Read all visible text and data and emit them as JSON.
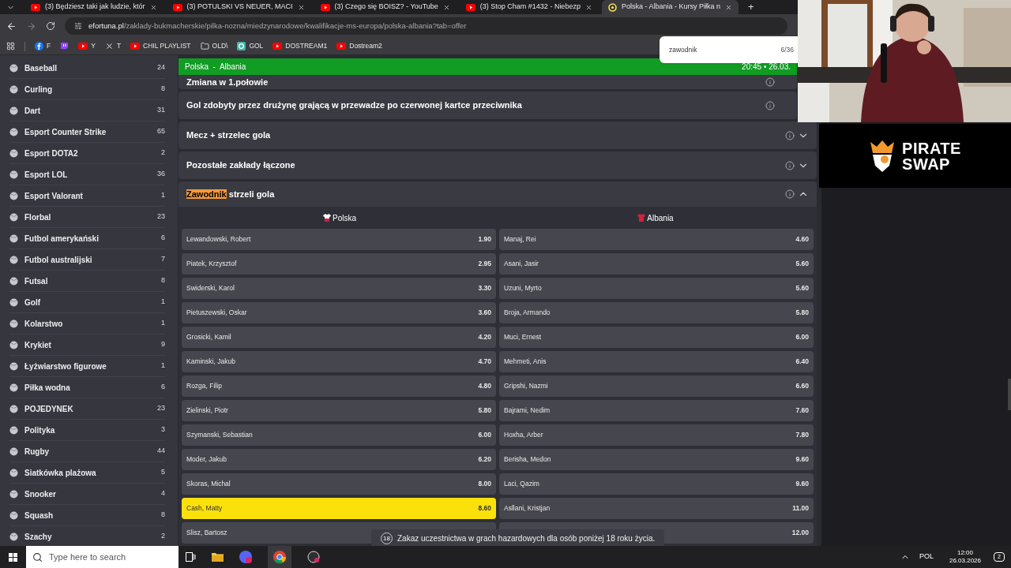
{
  "browser": {
    "tabs": [
      {
        "title": "(3) Będziesz taki jak ludzie, któr",
        "kind": "youtube",
        "selected": false
      },
      {
        "title": "(3) POTULSKI VS NEUER, MACI",
        "kind": "youtube",
        "selected": false
      },
      {
        "title": "(3) Czego się BOISZ? - YouTube",
        "kind": "youtube",
        "selected": false
      },
      {
        "title": "(3) Stop Cham #1432 - Niebezp",
        "kind": "youtube",
        "selected": false
      },
      {
        "title": "Polska - Albania - Kursy Piłka n",
        "kind": "site",
        "selected": true
      }
    ],
    "new_tab": "+",
    "address": {
      "domain": "efortuna.pl",
      "path": "/zaklady-bukmacherskie/pilka-nozna/miedzynarodowe/kwalifikacje-ms-europa/polska-albania?tab=offer"
    },
    "bookmarks": [
      {
        "label": "F",
        "kind": "facebook"
      },
      {
        "kind": "twitch"
      },
      {
        "label": "Y",
        "kind": "youtube"
      },
      {
        "label": "T",
        "kind": "x"
      },
      {
        "label": "CHIL PLAYLIST",
        "kind": "youtube"
      },
      {
        "label": "OLD\\",
        "kind": "folder"
      },
      {
        "label": "GOL",
        "kind": "g"
      },
      {
        "label": "DOSTREAM1",
        "kind": "youtube"
      },
      {
        "label": "Dostream2",
        "kind": "youtube"
      }
    ],
    "find_bar": {
      "value": "zawodnik",
      "count": "6/36"
    }
  },
  "sidebar": {
    "items": [
      {
        "name": "Baseball",
        "count": "24"
      },
      {
        "name": "Curling",
        "count": "8"
      },
      {
        "name": "Dart",
        "count": "31"
      },
      {
        "name": "Esport Counter Strike",
        "count": "65"
      },
      {
        "name": "Esport DOTA2",
        "count": "2"
      },
      {
        "name": "Esport LOL",
        "count": "36"
      },
      {
        "name": "Esport Valorant",
        "count": "1"
      },
      {
        "name": "Florbal",
        "count": "23"
      },
      {
        "name": "Futbol amerykański",
        "count": "6"
      },
      {
        "name": "Futbol australijski",
        "count": "7"
      },
      {
        "name": "Futsal",
        "count": "8"
      },
      {
        "name": "Golf",
        "count": "1"
      },
      {
        "name": "Kolarstwo",
        "count": "1"
      },
      {
        "name": "Krykiet",
        "count": "9"
      },
      {
        "name": "Łyżwiarstwo figurowe",
        "count": "1"
      },
      {
        "name": "Piłka wodna",
        "count": "6"
      },
      {
        "name": "POJEDYNEK",
        "count": "23"
      },
      {
        "name": "Polityka",
        "count": "3"
      },
      {
        "name": "Rugby",
        "count": "44"
      },
      {
        "name": "Siatkówka plażowa",
        "count": "5"
      },
      {
        "name": "Snooker",
        "count": "4"
      },
      {
        "name": "Squash",
        "count": "8"
      },
      {
        "name": "Szachy",
        "count": "2"
      }
    ]
  },
  "event_bar": {
    "title": "Polska  -  Albania",
    "time": "20:45 • 26.03."
  },
  "markets": [
    {
      "title_parts": [
        {
          "text": "Zmiana w 1.połowie",
          "highlighted": false
        }
      ],
      "partial": true
    },
    {
      "title_parts": [
        {
          "text": "Gol zdobyty przez drużynę grającą w przewadze po czerwonej kartce przeciwnika",
          "highlighted": false
        }
      ],
      "partial": false
    },
    {
      "title_parts": [
        {
          "text": "Mecz + strzelec gola",
          "highlighted": false
        }
      ],
      "partial": false,
      "expanded": false
    },
    {
      "title_parts": [
        {
          "text": "Pozostałe zakłady łączone",
          "highlighted": false
        }
      ],
      "partial": false,
      "expanded": false
    },
    {
      "title_parts": [
        {
          "text": "Zawodnik",
          "highlighted": true
        },
        {
          "text": " strzeli gola",
          "highlighted": false
        }
      ],
      "partial": false,
      "expanded": true
    }
  ],
  "scorer": {
    "teams": [
      {
        "name": "Polska",
        "kind": "white-red"
      },
      {
        "name": "Albania",
        "kind": "red"
      }
    ],
    "rows": [
      [
        {
          "name": "Lewandowski, Robert",
          "odds": "1.90",
          "selected": false
        },
        {
          "name": "Manaj, Rei",
          "odds": "4.60",
          "selected": false
        }
      ],
      [
        {
          "name": "Piatek, Krzysztof",
          "odds": "2.95",
          "selected": false
        },
        {
          "name": "Asani, Jasir",
          "odds": "5.60",
          "selected": false
        }
      ],
      [
        {
          "name": "Swiderski, Karol",
          "odds": "3.30",
          "selected": false
        },
        {
          "name": "Uzuni, Myrto",
          "odds": "5.60",
          "selected": false
        }
      ],
      [
        {
          "name": "Pietuszewski, Oskar",
          "odds": "3.60",
          "selected": false
        },
        {
          "name": "Broja, Armando",
          "odds": "5.80",
          "selected": false
        }
      ],
      [
        {
          "name": "Grosicki, Kamil",
          "odds": "4.20",
          "selected": false
        },
        {
          "name": "Muci, Ernest",
          "odds": "6.00",
          "selected": false
        }
      ],
      [
        {
          "name": "Kaminski, Jakub",
          "odds": "4.70",
          "selected": false
        },
        {
          "name": "Mehmeti, Anis",
          "odds": "6.40",
          "selected": false
        }
      ],
      [
        {
          "name": "Rozga, Filip",
          "odds": "4.80",
          "selected": false
        },
        {
          "name": "Gripshi, Nazmi",
          "odds": "6.60",
          "selected": false
        }
      ],
      [
        {
          "name": "Zielinski, Piotr",
          "odds": "5.80",
          "selected": false
        },
        {
          "name": "Bajrami, Nedim",
          "odds": "7.60",
          "selected": false
        }
      ],
      [
        {
          "name": "Szymanski, Sebastian",
          "odds": "6.00",
          "selected": false
        },
        {
          "name": "Hoxha, Arber",
          "odds": "7.80",
          "selected": false
        }
      ],
      [
        {
          "name": "Moder, Jakub",
          "odds": "6.20",
          "selected": false
        },
        {
          "name": "Berisha, Medon",
          "odds": "9.60",
          "selected": false
        }
      ],
      [
        {
          "name": "Skoras, Michal",
          "odds": "8.00",
          "selected": false
        },
        {
          "name": "Laci, Qazim",
          "odds": "9.60",
          "selected": false
        }
      ],
      [
        {
          "name": "Cash, Matty",
          "odds": "8.60",
          "selected": true
        },
        {
          "name": "Asllani, Kristjan",
          "odds": "11.00",
          "selected": false
        }
      ],
      [
        {
          "name": "Slisz, Bartosz",
          "selected": false
        },
        {
          "odds": "12.00",
          "selected": false
        }
      ]
    ]
  },
  "notice": {
    "badge": "18",
    "text": "Zakaz uczestnictwa w grach hazardowych dla osób poniżej 18 roku życia."
  },
  "overlay": {
    "logo": {
      "line1": "PIRATE",
      "line2": "SWAP"
    }
  },
  "taskbar": {
    "search_placeholder": "Type here to search",
    "language": "POL",
    "time": "12:00",
    "date": "26.03.2026",
    "notifications": "2"
  }
}
